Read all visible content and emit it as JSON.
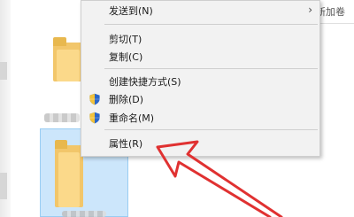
{
  "context_menu": {
    "items": [
      {
        "label": "发送到(N)",
        "has_submenu": true
      },
      {
        "label": "剪切(T)"
      },
      {
        "label": "复制(C)"
      },
      {
        "label": "创建快捷方式(S)"
      },
      {
        "label": "删除(D)",
        "icon": "uac-shield-icon"
      },
      {
        "label": "重命名(M)",
        "icon": "uac-shield-icon"
      },
      {
        "label": "属性(R)"
      }
    ]
  },
  "background_text": "新加卷",
  "colors": {
    "selection": "#cce6fb",
    "menu_background": "#f2f2f2",
    "arrow": "#e03131",
    "folder": "#f2c66a"
  }
}
